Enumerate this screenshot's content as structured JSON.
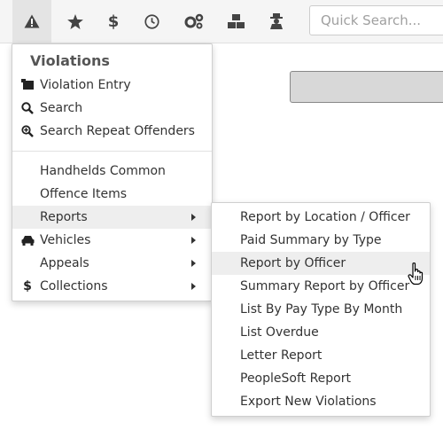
{
  "search": {
    "placeholder": "Quick Search..."
  },
  "toolbar": {
    "icons": [
      "warning-icon",
      "star-icon",
      "dollar-icon",
      "clock-icon",
      "gears-icon",
      "cubes-icon",
      "user-secret-icon"
    ]
  },
  "menu": {
    "title": "Violations",
    "items": [
      {
        "label": "Violation Entry",
        "icon": "ticket-icon"
      },
      {
        "label": "Search",
        "icon": "search-icon"
      },
      {
        "label": "Search Repeat Offenders",
        "icon": "zoom-in-icon"
      },
      {
        "label": "Handhelds Common"
      },
      {
        "label": "Offence Items"
      },
      {
        "label": "Reports",
        "submenu": true
      },
      {
        "label": "Vehicles",
        "icon": "car-icon",
        "submenu": true
      },
      {
        "label": "Appeals",
        "submenu": true
      },
      {
        "label": "Collections",
        "icon": "dollar-icon",
        "submenu": true
      }
    ]
  },
  "submenu": {
    "items": [
      "Report by Location / Officer",
      "Paid Summary by Type",
      "Report by Officer",
      "Summary Report by Officer",
      "List By Pay Type By Month",
      "List Overdue",
      "Letter Report",
      "PeopleSoft Report",
      "Export New Violations"
    ]
  }
}
